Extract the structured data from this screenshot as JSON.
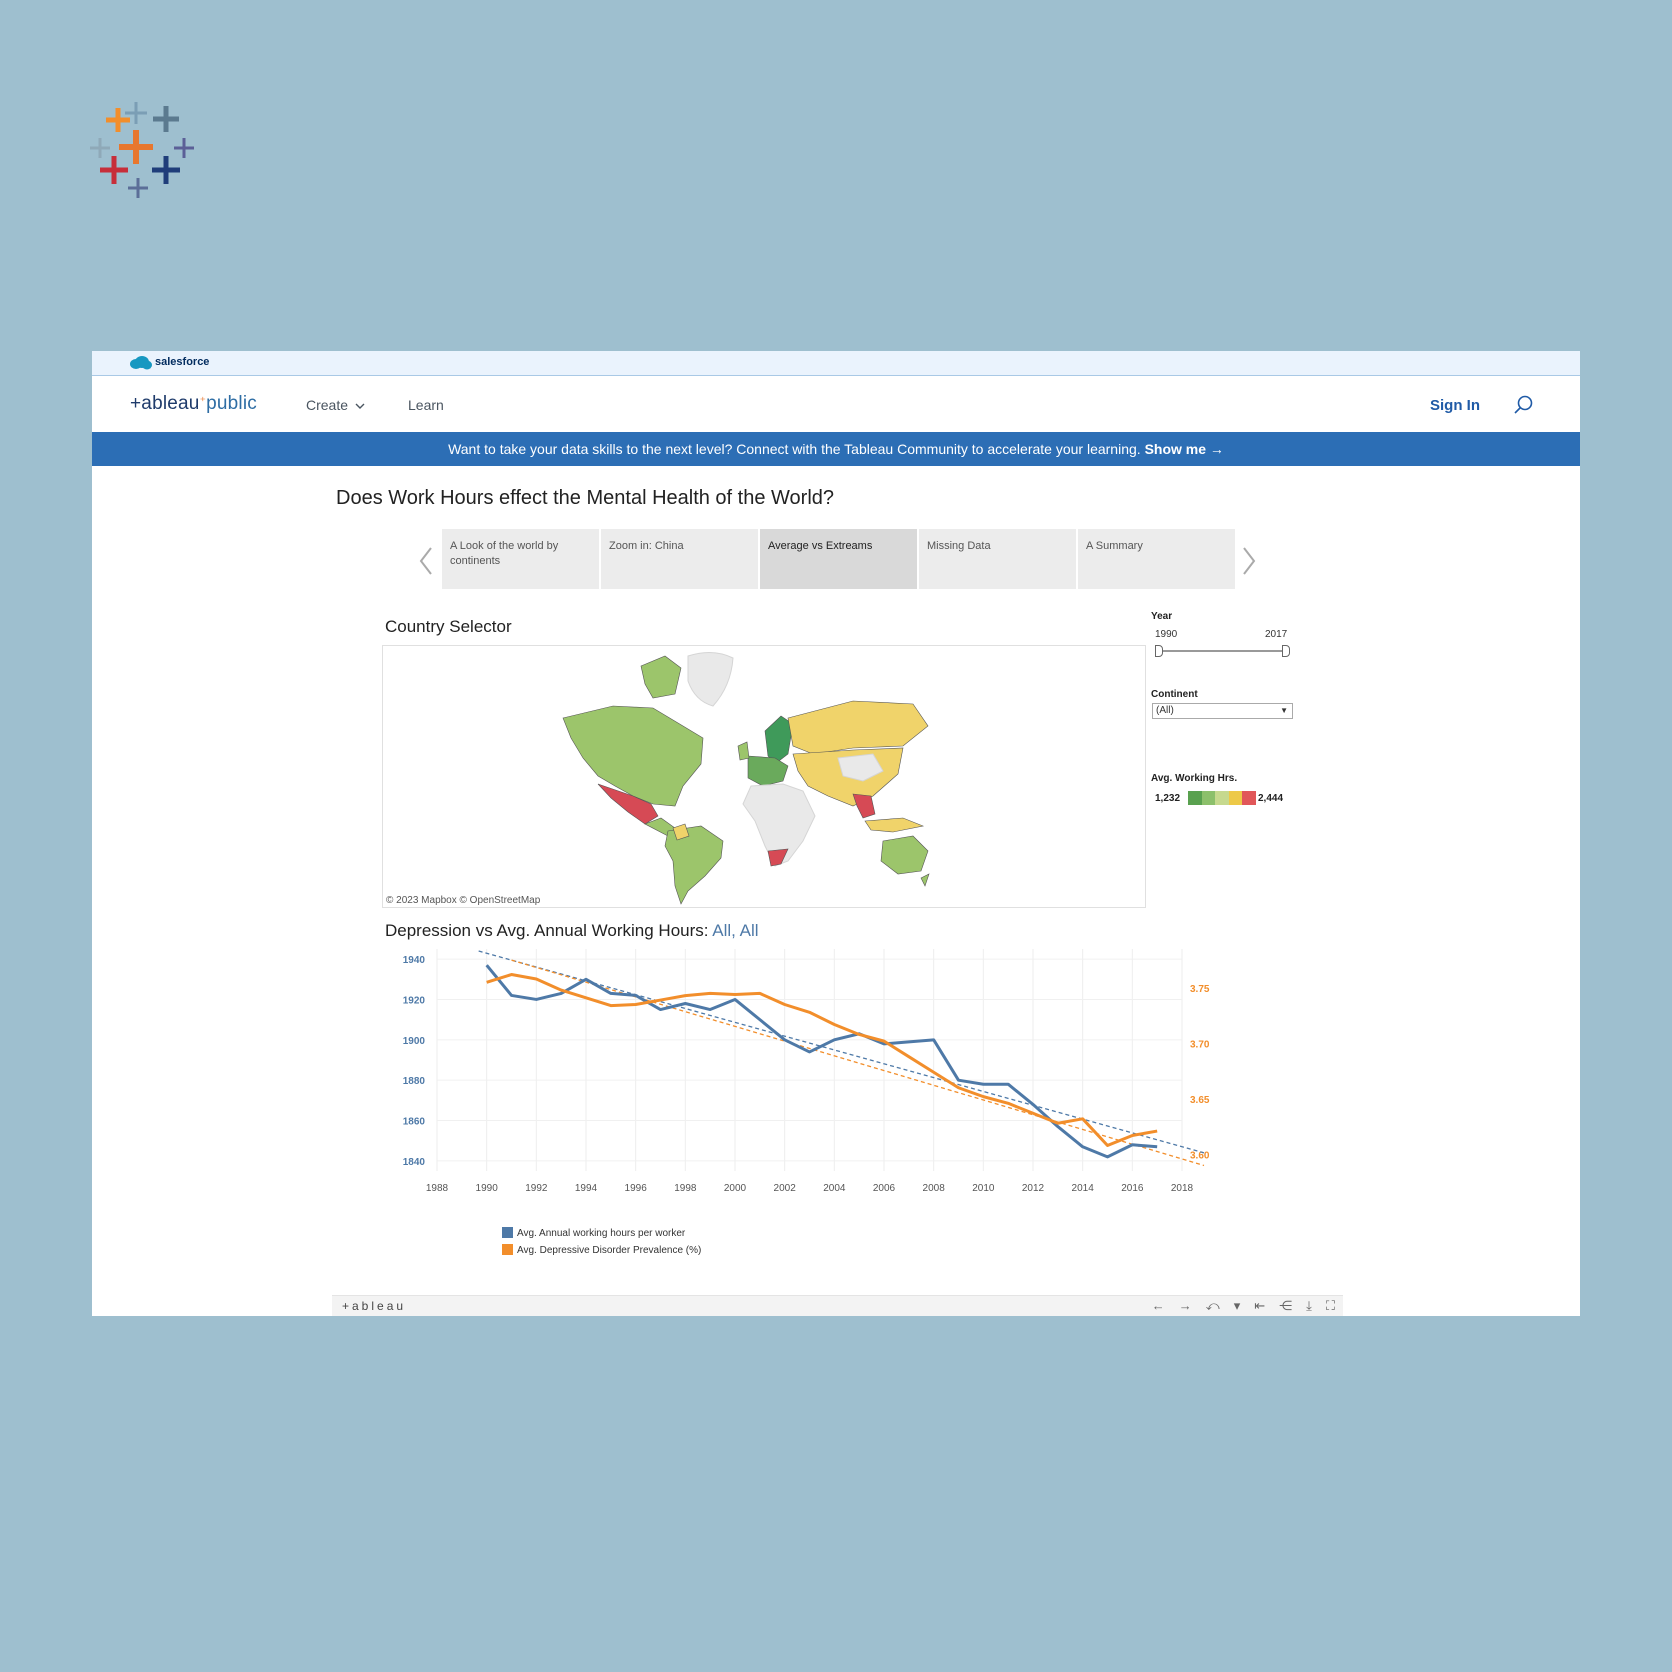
{
  "salesforce": {
    "label": "salesforce"
  },
  "nav": {
    "logo_main": "+ableau",
    "logo_sub": "public",
    "create_label": "Create",
    "learn_label": "Learn",
    "signin_label": "Sign In"
  },
  "banner": {
    "text": "Want to take your data skills to the next level? Connect with the Tableau Community to accelerate your learning. ",
    "cta": "Show me →"
  },
  "viz": {
    "title": "Does Work Hours effect the Mental Health of the World?",
    "story_tabs": [
      {
        "label": "A Look of the world by continents"
      },
      {
        "label": "Zoom in: China"
      },
      {
        "label": "Average vs Extreams"
      },
      {
        "label": "Missing Data"
      },
      {
        "label": "A Summary"
      }
    ],
    "active_tab": 2
  },
  "map": {
    "title": "Country Selector",
    "attribution": "© 2023 Mapbox  © OpenStreetMap"
  },
  "filters": {
    "year_label": "Year",
    "year_min": "1990",
    "year_max": "2017",
    "continent_label": "Continent",
    "continent_value": "(All)",
    "legend_title": "Avg. Working Hrs.",
    "legend_min": "1,232",
    "legend_max": "2,444",
    "ramp_colors": [
      "#59a14f",
      "#8cc06b",
      "#c6d98e",
      "#edc948",
      "#e15759"
    ]
  },
  "line_chart": {
    "title": "Depression vs Avg. Annual Working Hours:",
    "title_highlight": "All, All"
  },
  "colors": {
    "series1": "#4e79a7",
    "series2": "#f28e2b"
  },
  "chart_data": {
    "type": "line",
    "title": "Depression vs Avg. Annual Working Hours: All, All",
    "x": [
      1990,
      1991,
      1992,
      1993,
      1994,
      1995,
      1996,
      1997,
      1998,
      1999,
      2000,
      2001,
      2002,
      2003,
      2004,
      2005,
      2006,
      2007,
      2008,
      2009,
      2010,
      2011,
      2012,
      2013,
      2014,
      2015,
      2016,
      2017
    ],
    "xlim": [
      1988,
      2018
    ],
    "xticks": [
      "1988",
      "1990",
      "1992",
      "1994",
      "1996",
      "1998",
      "2000",
      "2002",
      "2004",
      "2006",
      "2008",
      "2010",
      "2012",
      "2014",
      "2016",
      "2018"
    ],
    "series": [
      {
        "name": "Avg. Annual working hours per worker",
        "axis": "left",
        "values": [
          1937,
          1922,
          1920,
          1923,
          1930,
          1923,
          1922,
          1915,
          1918,
          1915,
          1920,
          1910,
          1900,
          1894,
          1900,
          1903,
          1898,
          1899,
          1900,
          1880,
          1878,
          1878,
          1868,
          1857,
          1847,
          1842,
          1848,
          1847
        ]
      },
      {
        "name": "Avg. Depressive Disorder Prevalence (%)",
        "axis": "right",
        "values": [
          3.755,
          3.762,
          3.758,
          3.748,
          3.741,
          3.734,
          3.735,
          3.739,
          3.743,
          3.745,
          3.744,
          3.745,
          3.735,
          3.728,
          3.717,
          3.708,
          3.702,
          3.688,
          3.674,
          3.66,
          3.652,
          3.646,
          3.637,
          3.628,
          3.632,
          3.608,
          3.617,
          3.621
        ]
      }
    ],
    "trend_left": [
      1944,
      1844
    ],
    "trend_right": [
      3.775,
      3.59
    ],
    "y_left": {
      "ticks": [
        "1840",
        "1860",
        "1880",
        "1900",
        "1920",
        "1940"
      ],
      "lim": [
        1835,
        1945
      ]
    },
    "y_right": {
      "ticks": [
        "3.60",
        "3.65",
        "3.70",
        "3.75"
      ],
      "lim": [
        3.585,
        3.785
      ]
    },
    "legend": [
      "Avg. Annual working hours per worker",
      "Avg. Depressive Disorder Prevalence (%)"
    ]
  },
  "toolbar": {
    "brand": "+ableau",
    "icons": [
      "undo-icon",
      "redo-icon",
      "revert-icon",
      "dropdown-icon",
      "reset-icon",
      "share-icon",
      "download-icon",
      "fullscreen-icon"
    ]
  }
}
